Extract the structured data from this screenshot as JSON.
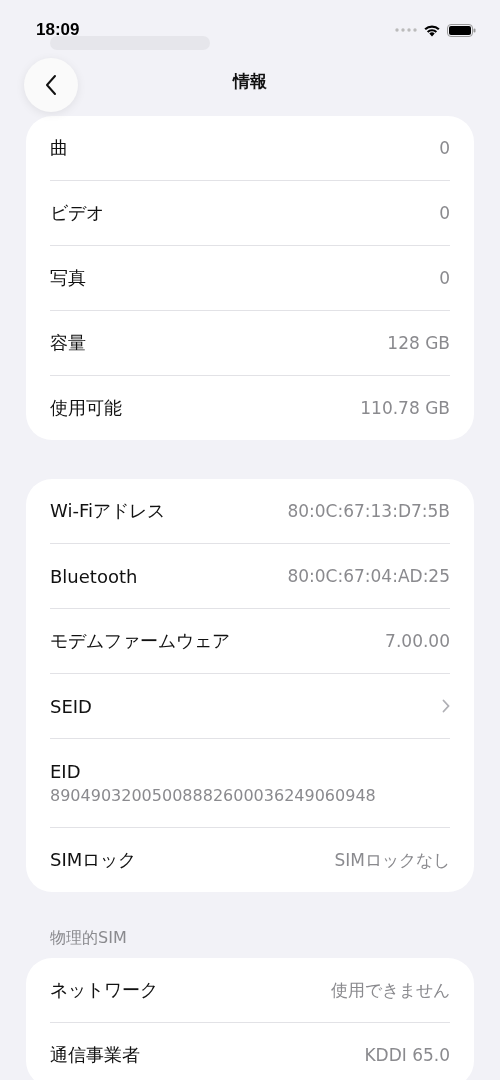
{
  "status_bar": {
    "time": "18:09"
  },
  "nav": {
    "title": "情報"
  },
  "sections": [
    {
      "rows": [
        {
          "kind": "value",
          "label": "曲",
          "value": "0"
        },
        {
          "kind": "value",
          "label": "ビデオ",
          "value": "0"
        },
        {
          "kind": "value",
          "label": "写真",
          "value": "0"
        },
        {
          "kind": "value",
          "label": "容量",
          "value": "128 GB"
        },
        {
          "kind": "value",
          "label": "使用可能",
          "value": "110.78 GB"
        }
      ]
    },
    {
      "rows": [
        {
          "kind": "value",
          "label": "Wi-Fiアドレス",
          "value": "80:0C:67:13:D7:5B"
        },
        {
          "kind": "value",
          "label": "Bluetooth",
          "value": "80:0C:67:04:AD:25"
        },
        {
          "kind": "value",
          "label": "モデムファームウェア",
          "value": "7.00.00"
        },
        {
          "kind": "chevron",
          "label": "SEID"
        },
        {
          "kind": "stacked",
          "label": "EID",
          "value": "89049032005008882600036249060948"
        },
        {
          "kind": "value",
          "label": "SIMロック",
          "value": "SIMロックなし"
        }
      ]
    },
    {
      "header": "物理的SIM",
      "rows": [
        {
          "kind": "value",
          "label": "ネットワーク",
          "value": "使用できません"
        },
        {
          "kind": "value",
          "label": "通信事業者",
          "value": "KDDI 65.0"
        }
      ]
    }
  ]
}
